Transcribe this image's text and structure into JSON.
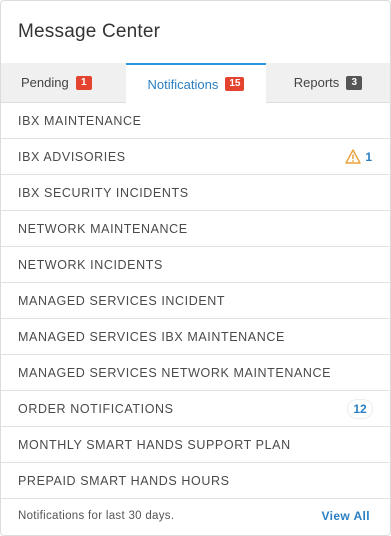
{
  "header": {
    "title": "Message Center"
  },
  "tabs": [
    {
      "label": "Pending",
      "count": "1",
      "active": false
    },
    {
      "label": "Notifications",
      "count": "15",
      "active": true
    },
    {
      "label": "Reports",
      "count": "3",
      "active": false
    }
  ],
  "items": [
    {
      "label": "IBX MAINTENANCE"
    },
    {
      "label": "IBX ADVISORIES",
      "icon": "warning-icon",
      "count": "1"
    },
    {
      "label": "IBX SECURITY INCIDENTS"
    },
    {
      "label": "NETWORK MAINTENANCE"
    },
    {
      "label": "NETWORK INCIDENTS"
    },
    {
      "label": "MANAGED SERVICES INCIDENT"
    },
    {
      "label": "MANAGED SERVICES IBX MAINTENANCE"
    },
    {
      "label": "MANAGED SERVICES NETWORK MAINTENANCE"
    },
    {
      "label": "ORDER NOTIFICATIONS",
      "count": "12"
    },
    {
      "label": "MONTHLY SMART HANDS SUPPORT PLAN"
    },
    {
      "label": "PREPAID SMART HANDS HOURS"
    }
  ],
  "footer": {
    "text": "Notifications for last 30 days.",
    "link_label": "View All"
  },
  "colors": {
    "accent": "#2b7fc2",
    "badge_red": "#e4432f",
    "badge_dark": "#555555",
    "warning": "#e8a23a"
  }
}
